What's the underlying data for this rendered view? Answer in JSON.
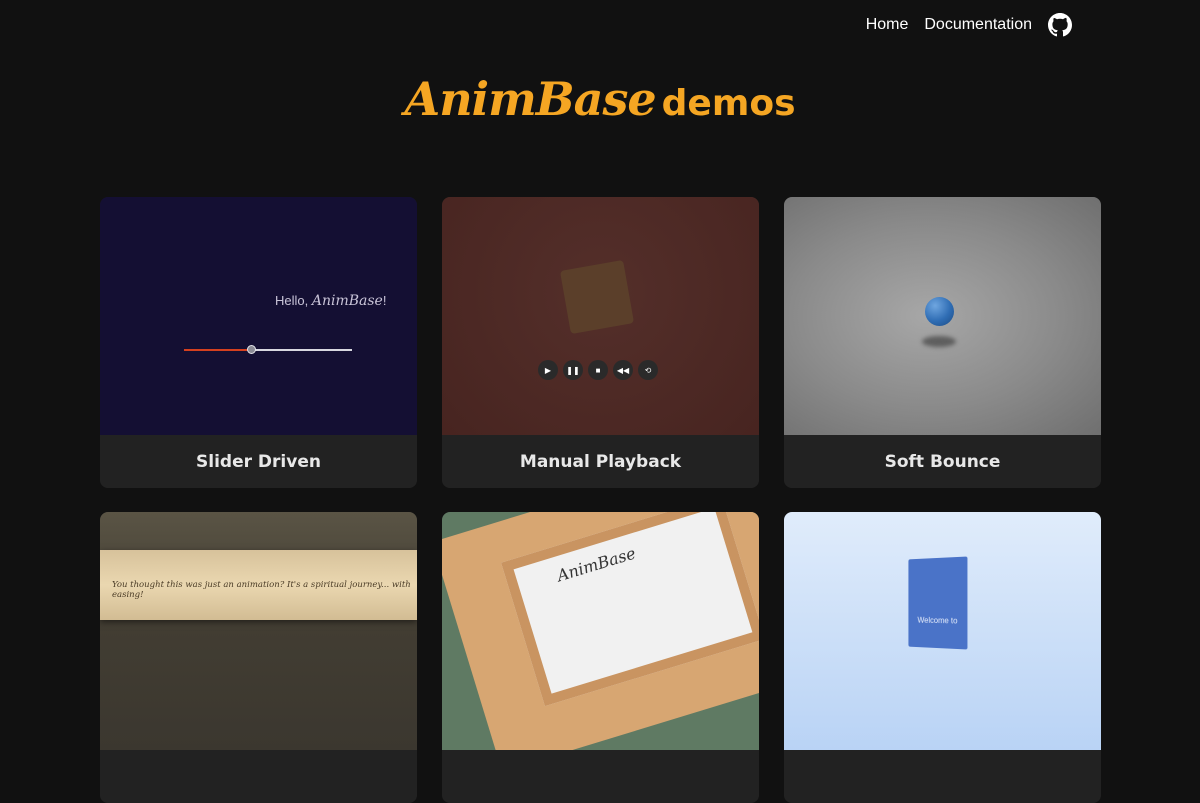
{
  "nav": {
    "home": "Home",
    "documentation": "Documentation",
    "github_icon": "github-icon"
  },
  "header": {
    "brand": "AnimBase",
    "suffix": "demos",
    "color": "#f5a623"
  },
  "cards": [
    {
      "label": "Slider Driven",
      "preview_text_prefix": "Hello, ",
      "preview_text_brand": "AnimBase",
      "preview_text_suffix": "!",
      "slider_progress": 0.4
    },
    {
      "label": "Manual Playback",
      "controls": [
        "play-icon",
        "pause-icon",
        "stop-icon",
        "rewind-icon",
        "loop-icon"
      ]
    },
    {
      "label": "Soft Bounce"
    },
    {
      "label": "",
      "preview_text": "You thought this was just an animation? It's a spiritual journey... with easing!"
    },
    {
      "label": "",
      "preview_text": "AnimBase"
    },
    {
      "label": "",
      "preview_text": "Welcome to"
    }
  ]
}
